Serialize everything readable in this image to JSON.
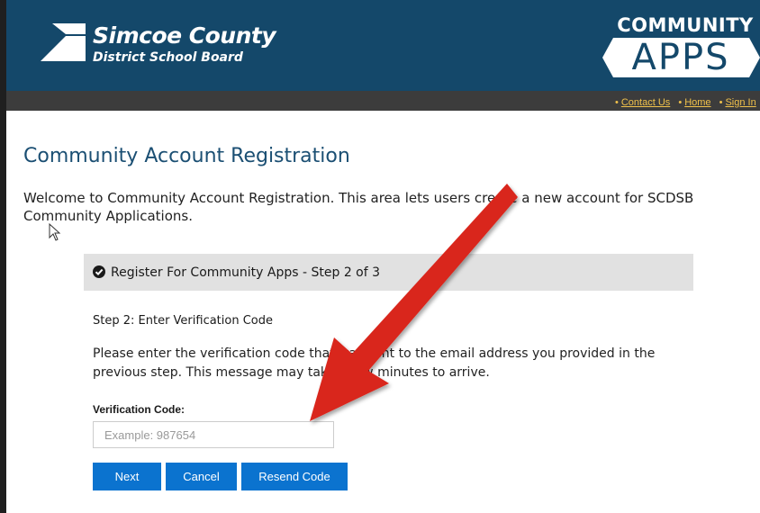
{
  "header": {
    "org_name_line1": "Simcoe County",
    "org_name_line2": "District School Board",
    "brand_top": "COMMUNITY",
    "brand_bottom": "APPS",
    "bg_color": "#14486a"
  },
  "nav": {
    "links": [
      "Contact Us",
      "Home",
      "Sign In"
    ],
    "link_color": "#f0c14b"
  },
  "page": {
    "title": "Community Account Registration",
    "intro": "Welcome to Community Account Registration. This area lets users create a new account for SCDSB Community Applications."
  },
  "panel": {
    "header_title": "Register For Community Apps - Step 2 of 3",
    "header_icon": "check-circle-icon",
    "step_heading": "Step 2: Enter Verification Code",
    "step_description": "Please enter the verification code that was sent to the email address you provided in the previous step. This message may take a few minutes to arrive.",
    "field_label": "Verification Code:",
    "field_placeholder": "Example: 987654",
    "field_value": "",
    "buttons": {
      "next": "Next",
      "cancel": "Cancel",
      "resend": "Resend Code"
    },
    "button_color": "#0b73cf"
  },
  "annotation": {
    "arrow_color": "#d9261c",
    "icon": "red-arrow-annotation"
  }
}
